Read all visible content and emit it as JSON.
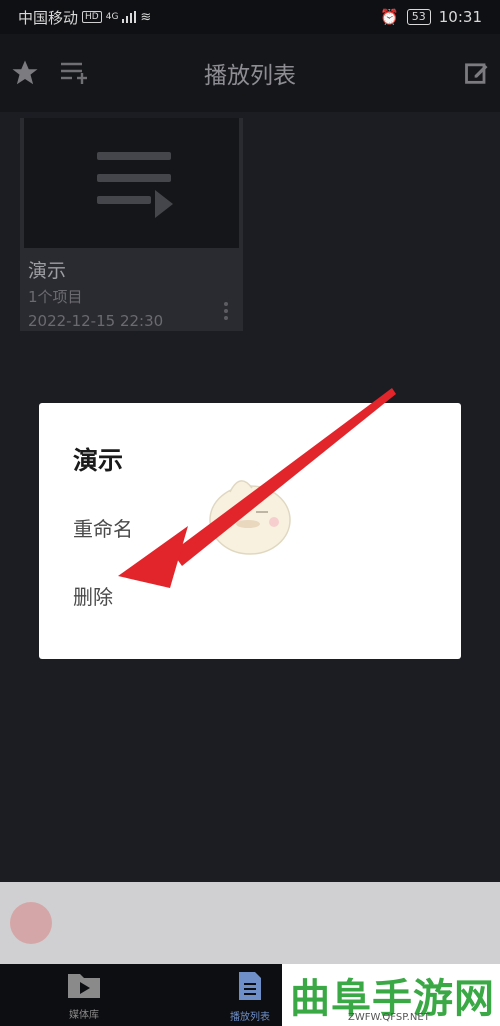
{
  "status_bar": {
    "carrier": "中国移动",
    "hd": "HD",
    "network": "4G",
    "battery": "53",
    "time": "10:31"
  },
  "header": {
    "title": "播放列表",
    "icons": [
      "star-icon",
      "add-playlist-icon",
      "edit-icon"
    ]
  },
  "playlist_card": {
    "name": "演示",
    "count": "1个项目",
    "date": "2022-12-15 22:30"
  },
  "dialog": {
    "title": "演示",
    "items": [
      "重命名",
      "删除"
    ]
  },
  "bottom_nav": {
    "items": [
      {
        "label": "媒体库",
        "icon": "folder-play-icon"
      },
      {
        "label": "播放列表",
        "icon": "document-icon"
      }
    ]
  },
  "watermark": {
    "text": "曲阜手游网",
    "url": "ZWFW.QFSP.NET"
  },
  "colors": {
    "background": "#1c1d22",
    "arrow": "#e2252b",
    "watermark_green": "#3aa845"
  }
}
